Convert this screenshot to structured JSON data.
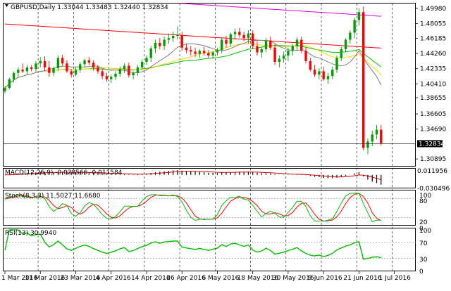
{
  "main": {
    "header": {
      "symbol_line": "GBPUSD,Daily  1.33044 1.33483 1.32440 1.32834"
    },
    "price_ticks": [
      "1.49980",
      "1.48055",
      "1.46185",
      "1.44260",
      "1.42335",
      "1.40410",
      "1.38655",
      "1.36605",
      "1.34690",
      "1.30895"
    ],
    "price_ylim": [
      1.302,
      1.505
    ],
    "current_price": "1.32834",
    "current_price_value": 1.32834
  },
  "macd": {
    "label": "MACD(12,26,9) -0.028566 -0.011584",
    "ticks": [
      "0.011956",
      "-0.030496"
    ]
  },
  "stoch": {
    "label": "Stoch(8,3,3) 11.5027 11.6680",
    "ticks": [
      "100",
      "80",
      "20",
      "0"
    ]
  },
  "rsi": {
    "label": "RSI(13) 30.9940",
    "ticks": [
      "100",
      "70",
      "30",
      "0"
    ]
  },
  "time_axis": {
    "labels": [
      "1 Mar 2016",
      "11 Mar 2016",
      "23 Mar 2016",
      "4 Apr 2016",
      "14 Apr 2016",
      "26 Apr 2016",
      "6 May 2016",
      "18 May 2016",
      "30 May 2016",
      "9 Jun 2016",
      "21 Jun 2016",
      "1 Jul 2016"
    ],
    "label_candle_index": [
      0,
      8,
      16,
      24,
      32,
      40,
      48,
      56,
      64,
      72,
      80,
      88
    ]
  },
  "colors": {
    "bull": "#00a000",
    "bear": "#ff0000",
    "ma_red": "#ff0000",
    "ma_green": "#00c000",
    "ma_yellow": "#ffd400",
    "ma_purple": "#e000e0",
    "ma_gray": "#808080",
    "macd_line": "#d00000",
    "stoch_main": "#00c000",
    "stoch_signal": "#ff0000",
    "rsi_line": "#00c000",
    "grid": "#000000"
  },
  "chart_data": {
    "type": "candlestick",
    "symbol": "GBPUSD",
    "timeframe": "Daily",
    "x_axis_labels": [
      "1 Mar 2016",
      "11 Mar 2016",
      "23 Mar 2016",
      "4 Apr 2016",
      "14 Apr 2016",
      "26 Apr 2016",
      "6 May 2016",
      "18 May 2016",
      "30 May 2016",
      "9 Jun 2016",
      "21 Jun 2016",
      "1 Jul 2016"
    ],
    "ylim": [
      1.302,
      1.505
    ],
    "candles": [
      [
        1.395,
        1.401,
        1.392,
        1.399
      ],
      [
        1.399,
        1.412,
        1.397,
        1.41
      ],
      [
        1.41,
        1.42,
        1.406,
        1.418
      ],
      [
        1.418,
        1.425,
        1.413,
        1.422
      ],
      [
        1.422,
        1.43,
        1.418,
        1.42
      ],
      [
        1.42,
        1.428,
        1.415,
        1.425
      ],
      [
        1.425,
        1.428,
        1.42,
        1.423
      ],
      [
        1.423,
        1.433,
        1.419,
        1.43
      ],
      [
        1.43,
        1.438,
        1.425,
        1.433
      ],
      [
        1.433,
        1.439,
        1.42,
        1.425
      ],
      [
        1.425,
        1.433,
        1.413,
        1.418
      ],
      [
        1.418,
        1.426,
        1.414,
        1.424
      ],
      [
        1.424,
        1.44,
        1.42,
        1.437
      ],
      [
        1.437,
        1.441,
        1.427,
        1.43
      ],
      [
        1.43,
        1.434,
        1.418,
        1.42
      ],
      [
        1.42,
        1.423,
        1.412,
        1.416
      ],
      [
        1.416,
        1.425,
        1.414,
        1.422
      ],
      [
        1.422,
        1.432,
        1.418,
        1.429
      ],
      [
        1.429,
        1.436,
        1.425,
        1.434
      ],
      [
        1.434,
        1.438,
        1.428,
        1.431
      ],
      [
        1.431,
        1.434,
        1.421,
        1.425
      ],
      [
        1.425,
        1.428,
        1.417,
        1.42
      ],
      [
        1.42,
        1.423,
        1.41,
        1.414
      ],
      [
        1.414,
        1.418,
        1.407,
        1.41
      ],
      [
        1.41,
        1.416,
        1.405,
        1.413
      ],
      [
        1.413,
        1.42,
        1.409,
        1.417
      ],
      [
        1.417,
        1.426,
        1.413,
        1.423
      ],
      [
        1.423,
        1.43,
        1.418,
        1.427
      ],
      [
        1.427,
        1.431,
        1.412,
        1.415
      ],
      [
        1.415,
        1.42,
        1.41,
        1.418
      ],
      [
        1.418,
        1.428,
        1.414,
        1.425
      ],
      [
        1.425,
        1.435,
        1.421,
        1.432
      ],
      [
        1.432,
        1.44,
        1.428,
        1.437
      ],
      [
        1.437,
        1.452,
        1.432,
        1.449
      ],
      [
        1.449,
        1.46,
        1.443,
        1.456
      ],
      [
        1.456,
        1.462,
        1.448,
        1.452
      ],
      [
        1.452,
        1.464,
        1.447,
        1.46
      ],
      [
        1.46,
        1.468,
        1.455,
        1.462
      ],
      [
        1.462,
        1.47,
        1.457,
        1.465
      ],
      [
        1.465,
        1.477,
        1.46,
        1.466
      ],
      [
        1.466,
        1.47,
        1.446,
        1.45
      ],
      [
        1.45,
        1.455,
        1.443,
        1.447
      ],
      [
        1.447,
        1.452,
        1.44,
        1.445
      ],
      [
        1.445,
        1.45,
        1.438,
        1.442
      ],
      [
        1.442,
        1.448,
        1.437,
        1.446
      ],
      [
        1.446,
        1.451,
        1.44,
        1.443
      ],
      [
        1.443,
        1.447,
        1.437,
        1.44
      ],
      [
        1.44,
        1.446,
        1.436,
        1.444
      ],
      [
        1.444,
        1.45,
        1.44,
        1.447
      ],
      [
        1.447,
        1.462,
        1.443,
        1.46
      ],
      [
        1.46,
        1.465,
        1.45,
        1.455
      ],
      [
        1.455,
        1.469,
        1.451,
        1.467
      ],
      [
        1.467,
        1.474,
        1.46,
        1.47
      ],
      [
        1.47,
        1.475,
        1.463,
        1.466
      ],
      [
        1.466,
        1.47,
        1.458,
        1.462
      ],
      [
        1.462,
        1.472,
        1.455,
        1.468
      ],
      [
        1.468,
        1.472,
        1.448,
        1.452
      ],
      [
        1.452,
        1.458,
        1.44,
        1.444
      ],
      [
        1.444,
        1.45,
        1.437,
        1.448
      ],
      [
        1.448,
        1.462,
        1.444,
        1.459
      ],
      [
        1.459,
        1.464,
        1.447,
        1.45
      ],
      [
        1.45,
        1.455,
        1.428,
        1.432
      ],
      [
        1.432,
        1.44,
        1.425,
        1.436
      ],
      [
        1.436,
        1.445,
        1.431,
        1.44
      ],
      [
        1.44,
        1.45,
        1.433,
        1.446
      ],
      [
        1.446,
        1.455,
        1.44,
        1.452
      ],
      [
        1.452,
        1.463,
        1.446,
        1.46
      ],
      [
        1.46,
        1.464,
        1.443,
        1.446
      ],
      [
        1.446,
        1.45,
        1.43,
        1.433
      ],
      [
        1.433,
        1.437,
        1.42,
        1.422
      ],
      [
        1.422,
        1.428,
        1.413,
        1.416
      ],
      [
        1.416,
        1.424,
        1.41,
        1.42
      ],
      [
        1.42,
        1.426,
        1.408,
        1.41
      ],
      [
        1.41,
        1.418,
        1.404,
        1.414
      ],
      [
        1.414,
        1.426,
        1.41,
        1.422
      ],
      [
        1.422,
        1.44,
        1.418,
        1.437
      ],
      [
        1.437,
        1.451,
        1.433,
        1.448
      ],
      [
        1.448,
        1.462,
        1.444,
        1.46
      ],
      [
        1.46,
        1.472,
        1.455,
        1.469
      ],
      [
        1.469,
        1.488,
        1.462,
        1.485
      ],
      [
        1.485,
        1.5,
        1.478,
        1.495
      ],
      [
        1.495,
        1.502,
        1.32,
        1.323
      ],
      [
        1.323,
        1.335,
        1.315,
        1.331
      ],
      [
        1.331,
        1.345,
        1.325,
        1.34
      ],
      [
        1.34,
        1.352,
        1.334,
        1.346
      ],
      [
        1.346,
        1.352,
        1.326,
        1.329
      ]
    ]
  }
}
